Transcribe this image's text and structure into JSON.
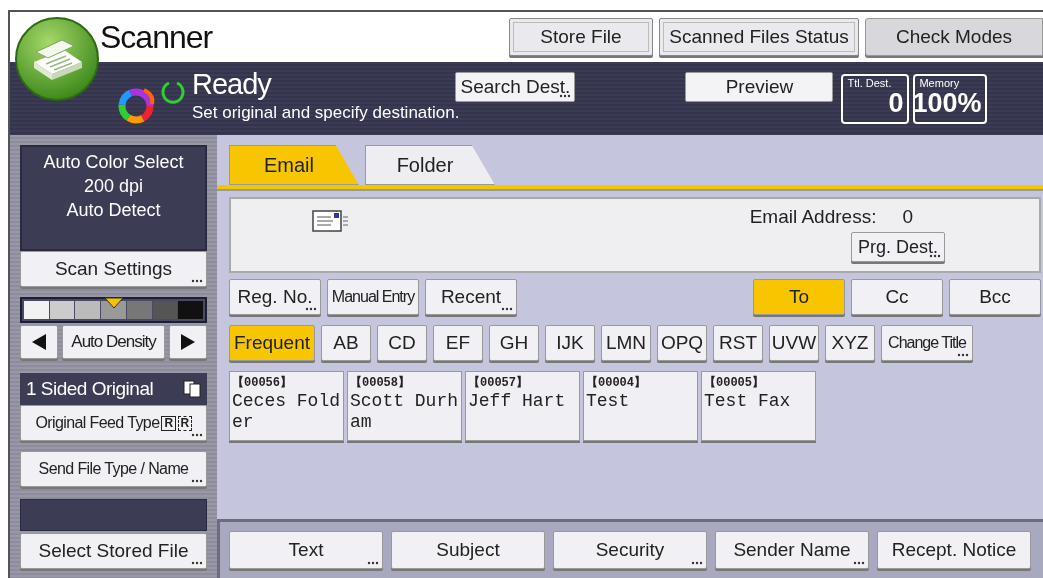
{
  "header": {
    "title": "Scanner",
    "buttons": [
      {
        "label": "Store File",
        "kind": "framed"
      },
      {
        "label": "Scanned Files Status",
        "kind": "framed"
      },
      {
        "label": "Check Modes",
        "kind": "plain"
      }
    ]
  },
  "status": {
    "state": "Ready",
    "message": "Set original and specify destination.",
    "search_button": {
      "label": "Search Dest.",
      "ellipsis": true
    },
    "preview_button": {
      "label": "Preview"
    },
    "counters": [
      {
        "label": "Ttl. Dest.",
        "value": "0"
      },
      {
        "label": "Memory",
        "value": "100%"
      }
    ]
  },
  "sidebar": {
    "settings": [
      "Auto Color Select",
      "200 dpi",
      "Auto Detect"
    ],
    "scan_settings": {
      "label": "Scan Settings",
      "ellipsis": true
    },
    "density": {
      "level": 0.5,
      "label": "Auto Density"
    },
    "original": {
      "label": "1 Sided Original"
    },
    "feed_type": {
      "label": "Original Feed Type",
      "badges": [
        "R",
        "R"
      ],
      "ellipsis": true
    },
    "file_type": {
      "label": "Send File Type / Name",
      "ellipsis": true
    },
    "stored": {
      "label": "Select Stored File",
      "ellipsis": true
    }
  },
  "tabs": [
    {
      "label": "Email",
      "selected": true
    },
    {
      "label": "Folder",
      "selected": false
    }
  ],
  "address": {
    "label": "Email Address:",
    "count": "0",
    "button": {
      "label": "Prg. Dest.",
      "ellipsis": true
    }
  },
  "entry_buttons": [
    {
      "label": "Reg. No.",
      "ellipsis": true
    },
    {
      "label": "Manual Entry"
    },
    {
      "label": "Recent",
      "ellipsis": true
    }
  ],
  "recipient_types": [
    {
      "label": "To",
      "selected": true
    },
    {
      "label": "Cc",
      "selected": false
    },
    {
      "label": "Bcc",
      "selected": false
    }
  ],
  "index_tabs": [
    {
      "label": "Frequent",
      "selected": true,
      "kind": "wide"
    },
    {
      "label": "AB",
      "selected": false,
      "kind": "letter"
    },
    {
      "label": "CD",
      "selected": false,
      "kind": "letter"
    },
    {
      "label": "EF",
      "selected": false,
      "kind": "letter"
    },
    {
      "label": "GH",
      "selected": false,
      "kind": "letter"
    },
    {
      "label": "IJK",
      "selected": false,
      "kind": "letter"
    },
    {
      "label": "LMN",
      "selected": false,
      "kind": "letter"
    },
    {
      "label": "OPQ",
      "selected": false,
      "kind": "letter"
    },
    {
      "label": "RST",
      "selected": false,
      "kind": "letter"
    },
    {
      "label": "UVW",
      "selected": false,
      "kind": "letter"
    },
    {
      "label": "XYZ",
      "selected": false,
      "kind": "letter"
    },
    {
      "label": "Change Title",
      "selected": false,
      "kind": "wide",
      "ellipsis": true
    }
  ],
  "destinations": [
    {
      "number": "【00056】",
      "name": "Ceces Folder"
    },
    {
      "number": "【00058】",
      "name": "Scott Durham"
    },
    {
      "number": "【00057】",
      "name": "Jeff Hart"
    },
    {
      "number": "【00004】",
      "name": "Test"
    },
    {
      "number": "【00005】",
      "name": "Test Fax"
    }
  ],
  "bottom_buttons": [
    {
      "label": "Text",
      "ellipsis": true
    },
    {
      "label": "Subject"
    },
    {
      "label": "Security",
      "ellipsis": true
    },
    {
      "label": "Sender Name",
      "ellipsis": true
    },
    {
      "label": "Recept. Notice"
    }
  ]
}
